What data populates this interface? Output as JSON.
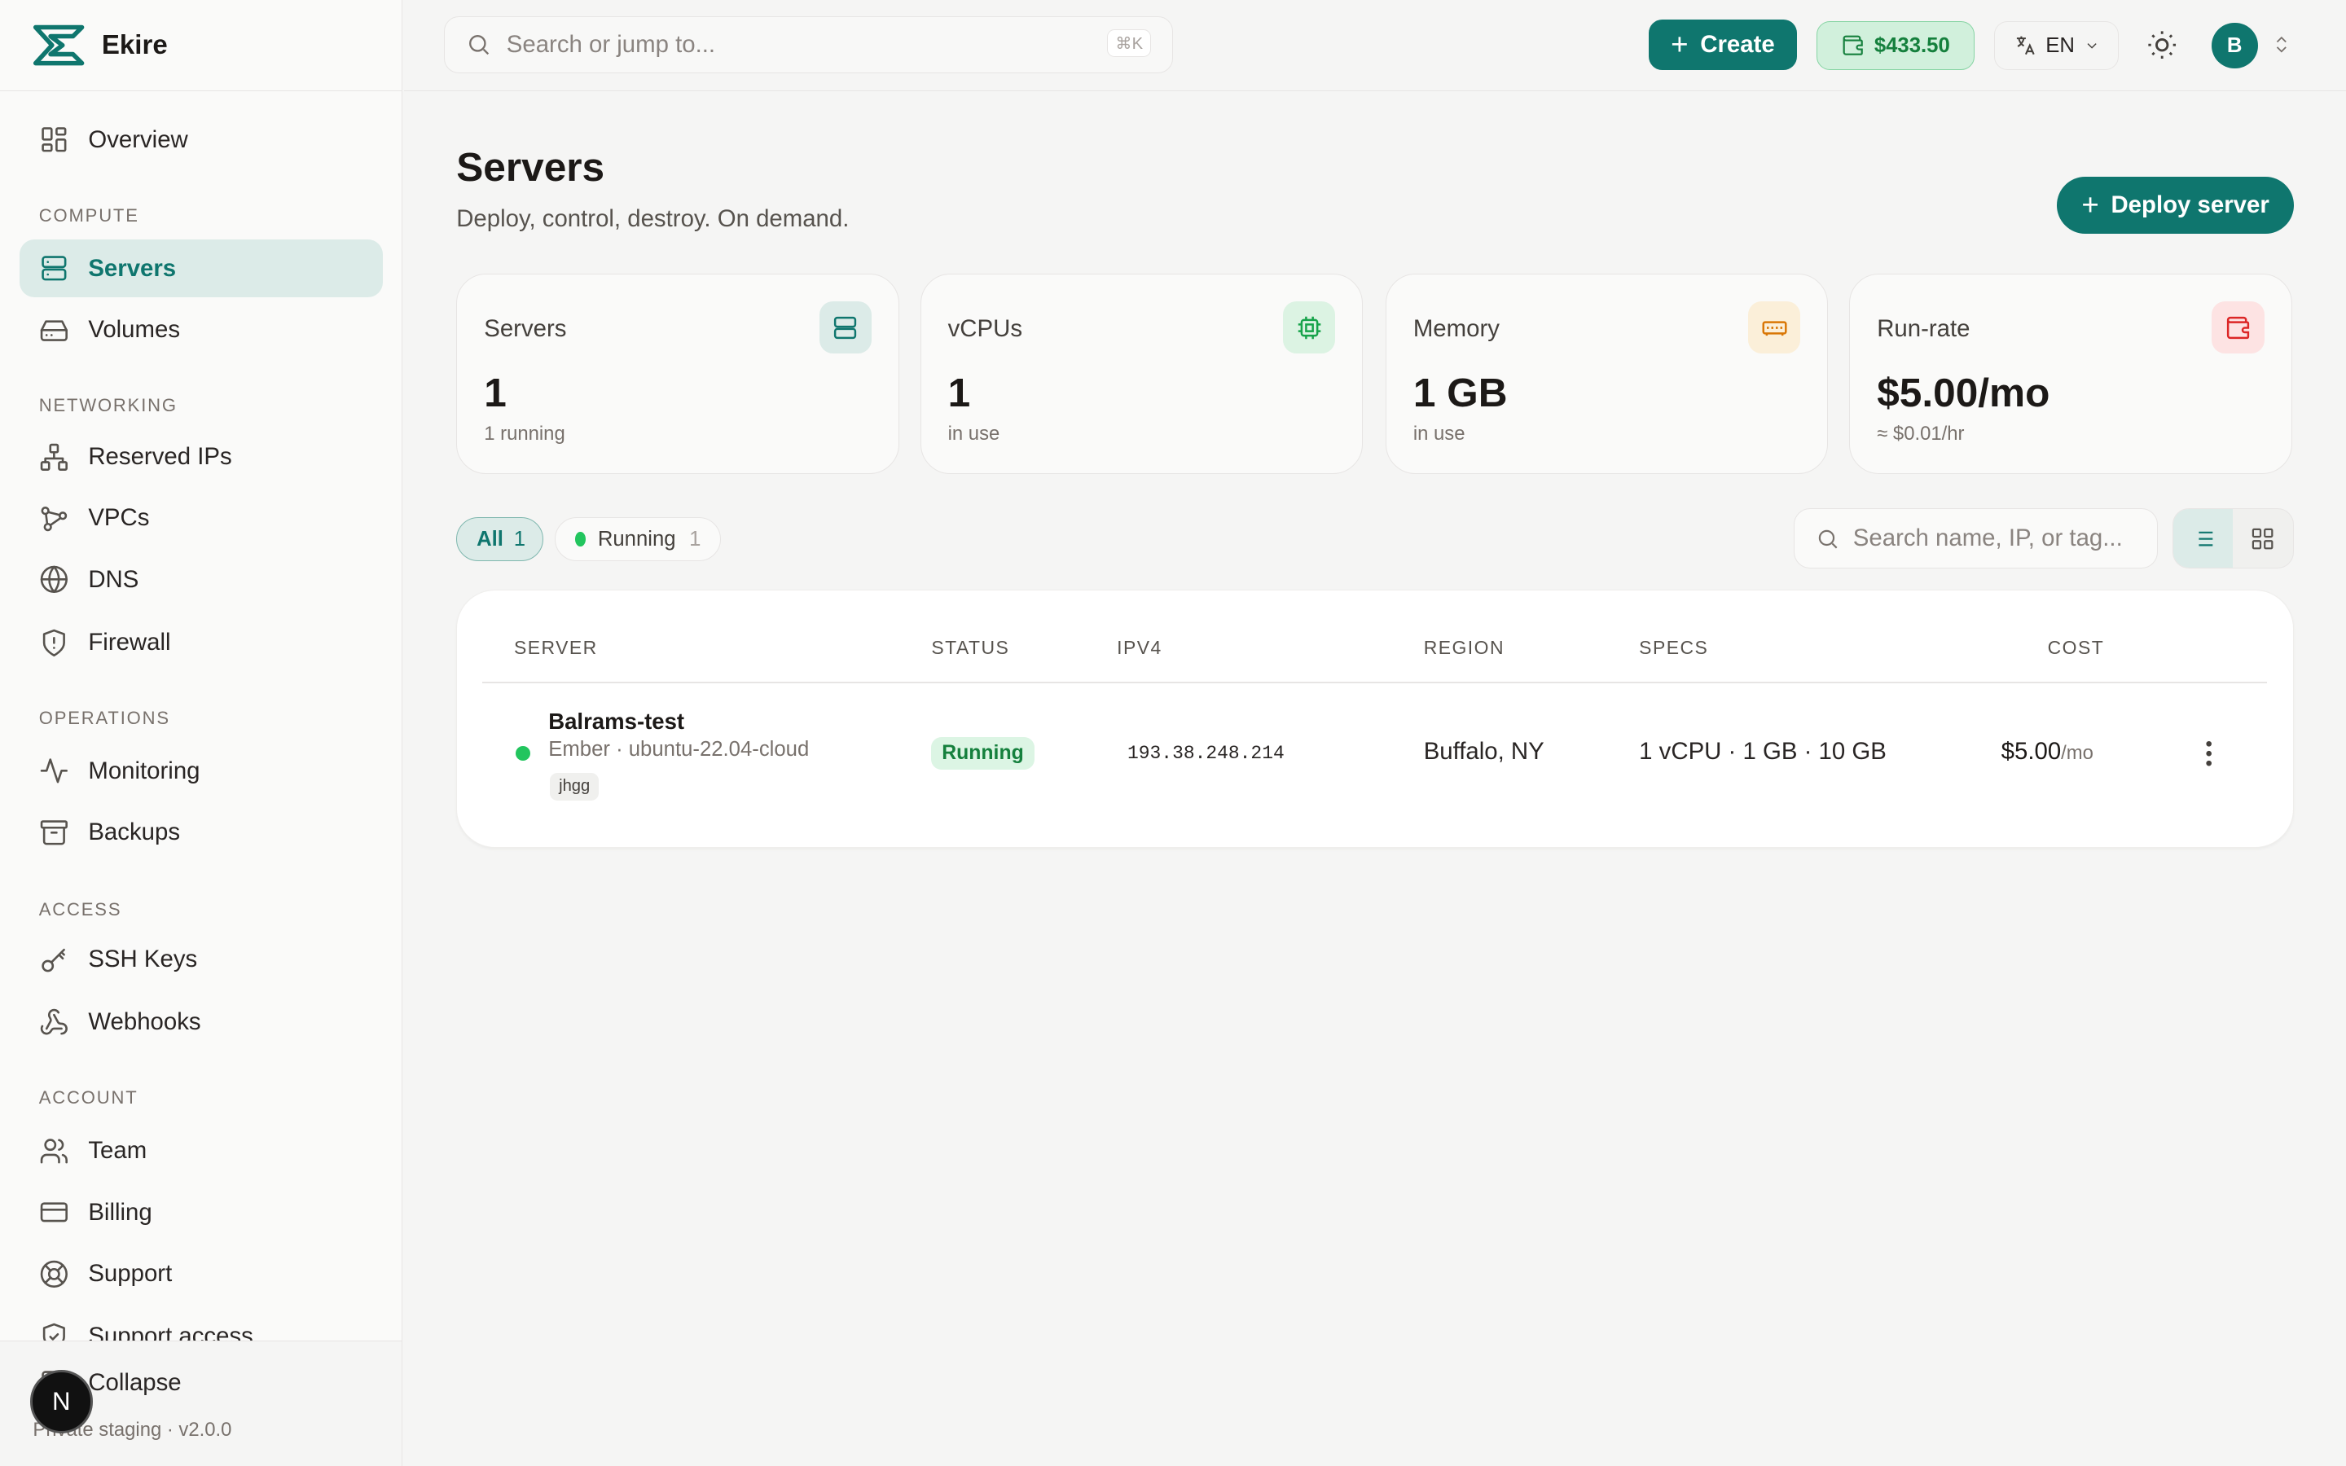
{
  "brand": {
    "name": "Ekire"
  },
  "sidebar": {
    "overview": "Overview",
    "sections": {
      "compute": "COMPUTE",
      "networking": "NETWORKING",
      "operations": "OPERATIONS",
      "access": "ACCESS",
      "account": "ACCOUNT"
    },
    "items": {
      "servers": "Servers",
      "volumes": "Volumes",
      "reserved_ips": "Reserved IPs",
      "vpcs": "VPCs",
      "dns": "DNS",
      "firewall": "Firewall",
      "monitoring": "Monitoring",
      "backups": "Backups",
      "ssh_keys": "SSH Keys",
      "webhooks": "Webhooks",
      "team": "Team",
      "billing": "Billing",
      "support": "Support",
      "support_access": "Support access"
    },
    "collapse": "Collapse",
    "version": "Private staging · v2.0.0",
    "n_badge": "N"
  },
  "topbar": {
    "search_placeholder": "Search or jump to...",
    "search_shortcut": "⌘K",
    "create_label": "Create",
    "balance": "$433.50",
    "language": "EN",
    "avatar_initial": "B"
  },
  "page": {
    "title": "Servers",
    "subtitle": "Deploy, control, destroy. On demand.",
    "deploy_label": "Deploy server"
  },
  "stats": [
    {
      "label": "Servers",
      "value": "1",
      "note": "1 running",
      "icon": "server-icon",
      "color": "#0f766e",
      "bg": "#dcebe8"
    },
    {
      "label": "vCPUs",
      "value": "1",
      "note": "in use",
      "icon": "cpu-icon",
      "color": "#16a34a",
      "bg": "#dcf3e3"
    },
    {
      "label": "Memory",
      "value": "1 GB",
      "note": "in use",
      "icon": "memory-icon",
      "color": "#d97706",
      "bg": "#fbefd9"
    },
    {
      "label": "Run-rate",
      "value": "$5.00/mo",
      "note": "≈ $0.01/hr",
      "icon": "wallet-icon",
      "color": "#dc2626",
      "bg": "#fde3e3"
    }
  ],
  "filters": {
    "all_label": "All",
    "all_count": "1",
    "running_label": "Running",
    "running_count": "1",
    "search_placeholder": "Search name, IP, or tag..."
  },
  "table": {
    "headers": {
      "server": "SERVER",
      "status": "STATUS",
      "ipv4": "IPV4",
      "region": "REGION",
      "specs": "SPECS",
      "cost": "COST"
    },
    "rows": [
      {
        "name": "Balrams-test",
        "sub": "Ember · ubuntu-22.04-cloud",
        "tag": "jhgg",
        "status": "Running",
        "ipv4": "193.38.248.214",
        "region": "Buffalo, NY",
        "specs": "1 vCPU · 1 GB · 10 GB",
        "cost": "$5.00",
        "cost_unit": "/mo"
      }
    ]
  },
  "colors": {
    "accent": "#0f766e",
    "running": "#22c55e",
    "background": "#f5f5f4"
  }
}
